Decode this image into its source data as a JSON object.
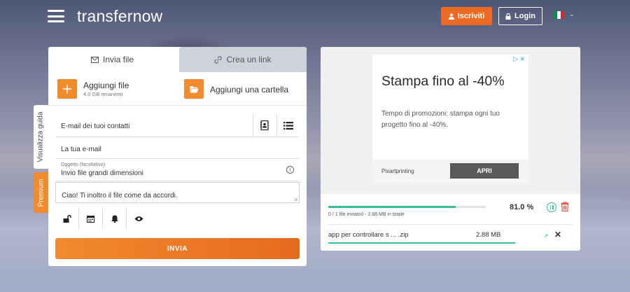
{
  "header": {
    "logo": "transfernow",
    "signup_label": "Iscriviti",
    "login_label": "Login",
    "language_flag_colors": [
      "#009246",
      "#ffffff",
      "#ce2b37"
    ]
  },
  "sidebar_tabs": {
    "guide": "Visualizza guida",
    "premium": "Premium"
  },
  "upload": {
    "tabs": [
      {
        "label": "Invia file",
        "icon": "envelope-icon",
        "active": true
      },
      {
        "label": "Crea un link",
        "icon": "link-icon",
        "active": false
      }
    ],
    "add_file_label": "Aggiungi file",
    "add_file_remaining": "4.0 GB rimanenti",
    "add_folder_label": "Aggiungi una cartella",
    "contacts_placeholder": "E-mail dei tuoi contatti",
    "sender_placeholder": "La tua e-mail",
    "subject_label": "Oggetto (facoltativo)",
    "subject_value": "Invio file grandi dimensioni",
    "message_value": "Ciao! Ti inoltro il file come da accordi.",
    "option_icons": [
      "lock-icon",
      "calendar-icon",
      "bell-icon",
      "eye-icon"
    ],
    "send_label": "INVIA"
  },
  "ad": {
    "title": "Stampa fino al -40%",
    "text": "Tempo di promozioni: stampa ogni tuo progetto fino al -40%.",
    "brand": "Pixartprinting",
    "cta": "APRI"
  },
  "transfer": {
    "progress_fraction": 0.81,
    "percent_text": "81.0 %",
    "status_text": "0 / 1 file inviato/i - 2.88 MB in totale",
    "file_name": "app per controllare s ... .zip",
    "file_size": "2.88 MB",
    "file_progress_fraction": 0.99,
    "accent_color": "#37c08f",
    "delete_color": "#e0534a"
  }
}
